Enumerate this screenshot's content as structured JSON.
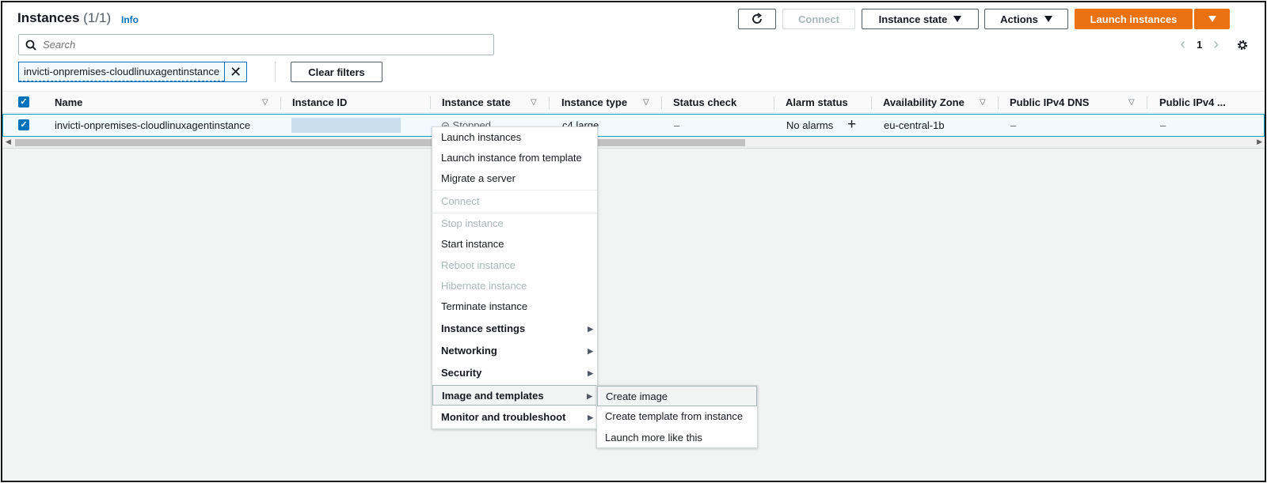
{
  "header": {
    "title": "Instances",
    "count": "(1/1)",
    "info": "Info",
    "buttons": {
      "connect": "Connect",
      "instance_state": "Instance state",
      "actions": "Actions",
      "launch": "Launch instances"
    },
    "search_placeholder": "Search",
    "filter_token": "invicti-onpremises-cloudlinuxagentinstance",
    "clear_filters": "Clear filters",
    "page": "1"
  },
  "table": {
    "columns": [
      "Name",
      "Instance ID",
      "Instance state",
      "Instance type",
      "Status check",
      "Alarm status",
      "Availability Zone",
      "Public IPv4 DNS",
      "Public IPv4 ..."
    ],
    "row": {
      "name": "invicti-onpremises-cloudlinuxagentinstance",
      "state": "Stopped",
      "type": "c4.large",
      "status_check": "–",
      "alarm": "No alarms",
      "zone": "eu-central-1b",
      "dns": "–",
      "ipv4": "–"
    }
  },
  "menu": {
    "items": [
      "Launch instances",
      "Launch instance from template",
      "Migrate a server",
      "Connect",
      "Stop instance",
      "Start instance",
      "Reboot instance",
      "Hibernate instance",
      "Terminate instance",
      "Instance settings",
      "Networking",
      "Security",
      "Image and templates",
      "Monitor and troubleshoot"
    ],
    "submenu": [
      "Create image",
      "Create template from instance",
      "Launch more like this"
    ]
  },
  "colors": {
    "accent": "#0073bb",
    "primary_button": "#ec7211",
    "selected_row": "#f1faff",
    "disabled_text": "#aab7b8"
  },
  "icons": {
    "refresh": "refresh-icon",
    "search": "search-icon",
    "settings": "gear-icon",
    "close": "close-icon",
    "add": "plus-icon"
  }
}
